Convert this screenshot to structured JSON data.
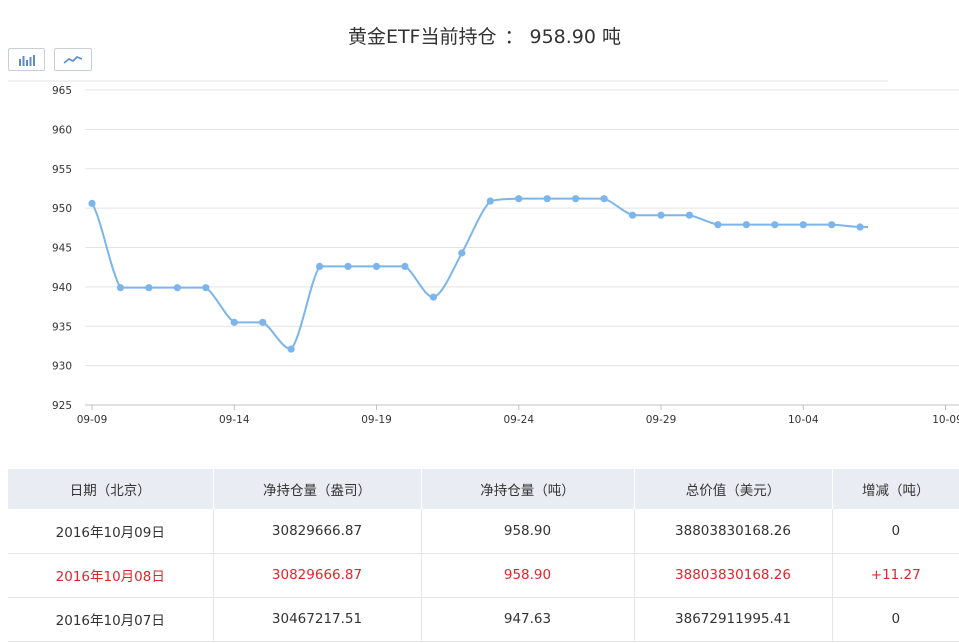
{
  "header": {
    "title_label": "黄金ETF当前持仓",
    "separator": "：",
    "current_value": "958.90",
    "unit": "吨"
  },
  "toolbar": {
    "bar_view_icon": "bar-chart-icon",
    "line_view_icon": "line-chart-icon"
  },
  "chart_data": {
    "type": "line",
    "x": [
      "09-09",
      "09-10",
      "09-11",
      "09-12",
      "09-13",
      "09-14",
      "09-15",
      "09-16",
      "09-17",
      "09-18",
      "09-19",
      "09-20",
      "09-21",
      "09-22",
      "09-23",
      "09-24",
      "09-25",
      "09-26",
      "09-27",
      "09-28",
      "09-29",
      "09-30",
      "10-01",
      "10-02",
      "10-03",
      "10-04",
      "10-05",
      "10-06"
    ],
    "series": [
      {
        "values": [
          950.6,
          939.9,
          939.9,
          939.9,
          939.9,
          935.5,
          935.5,
          932.1,
          942.6,
          942.6,
          942.6,
          942.6,
          938.7,
          944.3,
          950.9,
          951.2,
          951.2,
          951.2,
          951.2,
          949.1,
          949.1,
          949.1,
          947.9,
          947.9,
          947.9,
          947.9,
          947.9,
          947.6
        ]
      }
    ],
    "xticks": [
      "09-09",
      "09-14",
      "09-19",
      "09-24",
      "09-29",
      "10-04",
      "10-09"
    ],
    "yticks": [
      925,
      930,
      935,
      940,
      945,
      950,
      955,
      960,
      965
    ],
    "ylim": [
      925,
      965
    ],
    "grid": true,
    "color": "#7cb5ec"
  },
  "table": {
    "headers": [
      "日期（北京）",
      "净持仓量（盎司）",
      "净持仓量（吨）",
      "总价值（美元）",
      "增减（吨）"
    ],
    "rows": [
      {
        "date": "2016年10月09日",
        "ounces": "30829666.87",
        "tonnes": "958.90",
        "value": "38803830168.26",
        "change": "0",
        "trend": "flat"
      },
      {
        "date": "2016年10月08日",
        "ounces": "30829666.87",
        "tonnes": "958.90",
        "value": "38803830168.26",
        "change": "+11.27",
        "trend": "up"
      },
      {
        "date": "2016年10月07日",
        "ounces": "30467217.51",
        "tonnes": "947.63",
        "value": "38672911995.41",
        "change": "0",
        "trend": "flat"
      }
    ]
  }
}
